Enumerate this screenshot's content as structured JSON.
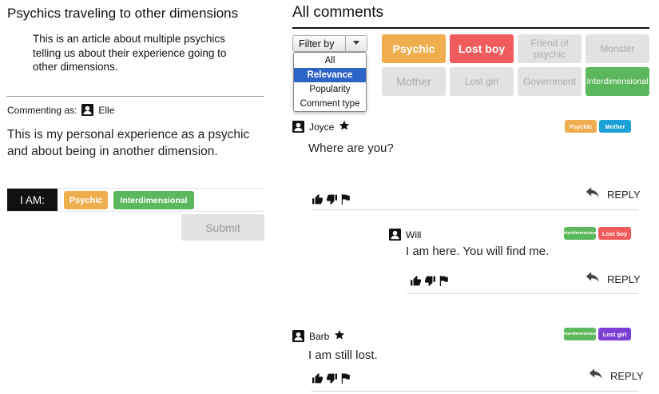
{
  "article": {
    "title": "Psychics traveling to other dimensions",
    "body": "This is an article about multiple psychics telling us about their experience going to other dimensions."
  },
  "composer": {
    "commenting_as_label": "Commenting as:",
    "user": "Elle",
    "draft_text": "This is my personal experience as a psychic and about being in another dimension.",
    "i_am_label": "I AM:",
    "selected_tags": [
      "Psychic",
      "Interdimensional"
    ],
    "submit_label": "Submit"
  },
  "comments_panel": {
    "title": "All comments",
    "filter": {
      "label": "Filter by",
      "options": [
        "All",
        "Relevance",
        "Popularity",
        "Comment type"
      ],
      "highlighted": "Relevance"
    },
    "filter_tags": [
      {
        "label": "Psychic",
        "state": "active",
        "color": "#f0ad4e"
      },
      {
        "label": "Lost boy",
        "state": "active",
        "color": "#f15b5b"
      },
      {
        "label": "Friend of psychic",
        "state": "inactive"
      },
      {
        "label": "Monster",
        "state": "inactive"
      },
      {
        "label": "Mother",
        "state": "inactive"
      },
      {
        "label": "Lost girl",
        "state": "inactive"
      },
      {
        "label": "Government",
        "state": "inactive"
      },
      {
        "label": "Interdimensional",
        "state": "active",
        "color": "#5cb85c"
      }
    ],
    "comments": [
      {
        "author": "Joyce",
        "starred": true,
        "text": "Where are you?",
        "tags": [
          "Psychic",
          "Mother"
        ],
        "reply_label": "REPLY"
      },
      {
        "author": "Will",
        "starred": false,
        "text": "I am here. You will find me.",
        "tags": [
          "Interdimensional",
          "Lost boy"
        ],
        "reply_label": "REPLY"
      },
      {
        "author": "Barb",
        "starred": true,
        "text": "I am still lost.",
        "tags": [
          "Interdimensional",
          "Lost girl"
        ],
        "reply_label": "REPLY"
      }
    ]
  },
  "colors": {
    "psychic": "#f0ad4e",
    "lost_boy": "#f15b5b",
    "interdimensional": "#5cb85c",
    "mother": "#1ba1d8",
    "lost_girl": "#7b3fd6",
    "inactive_tag": "#e2e2e2",
    "dropdown_highlight": "#2d64c8"
  },
  "icons": [
    "user-icon",
    "star-icon",
    "thumbs-up-icon",
    "thumbs-down-icon",
    "flag-icon",
    "reply-arrow-icon",
    "dropdown-caret-icon"
  ]
}
